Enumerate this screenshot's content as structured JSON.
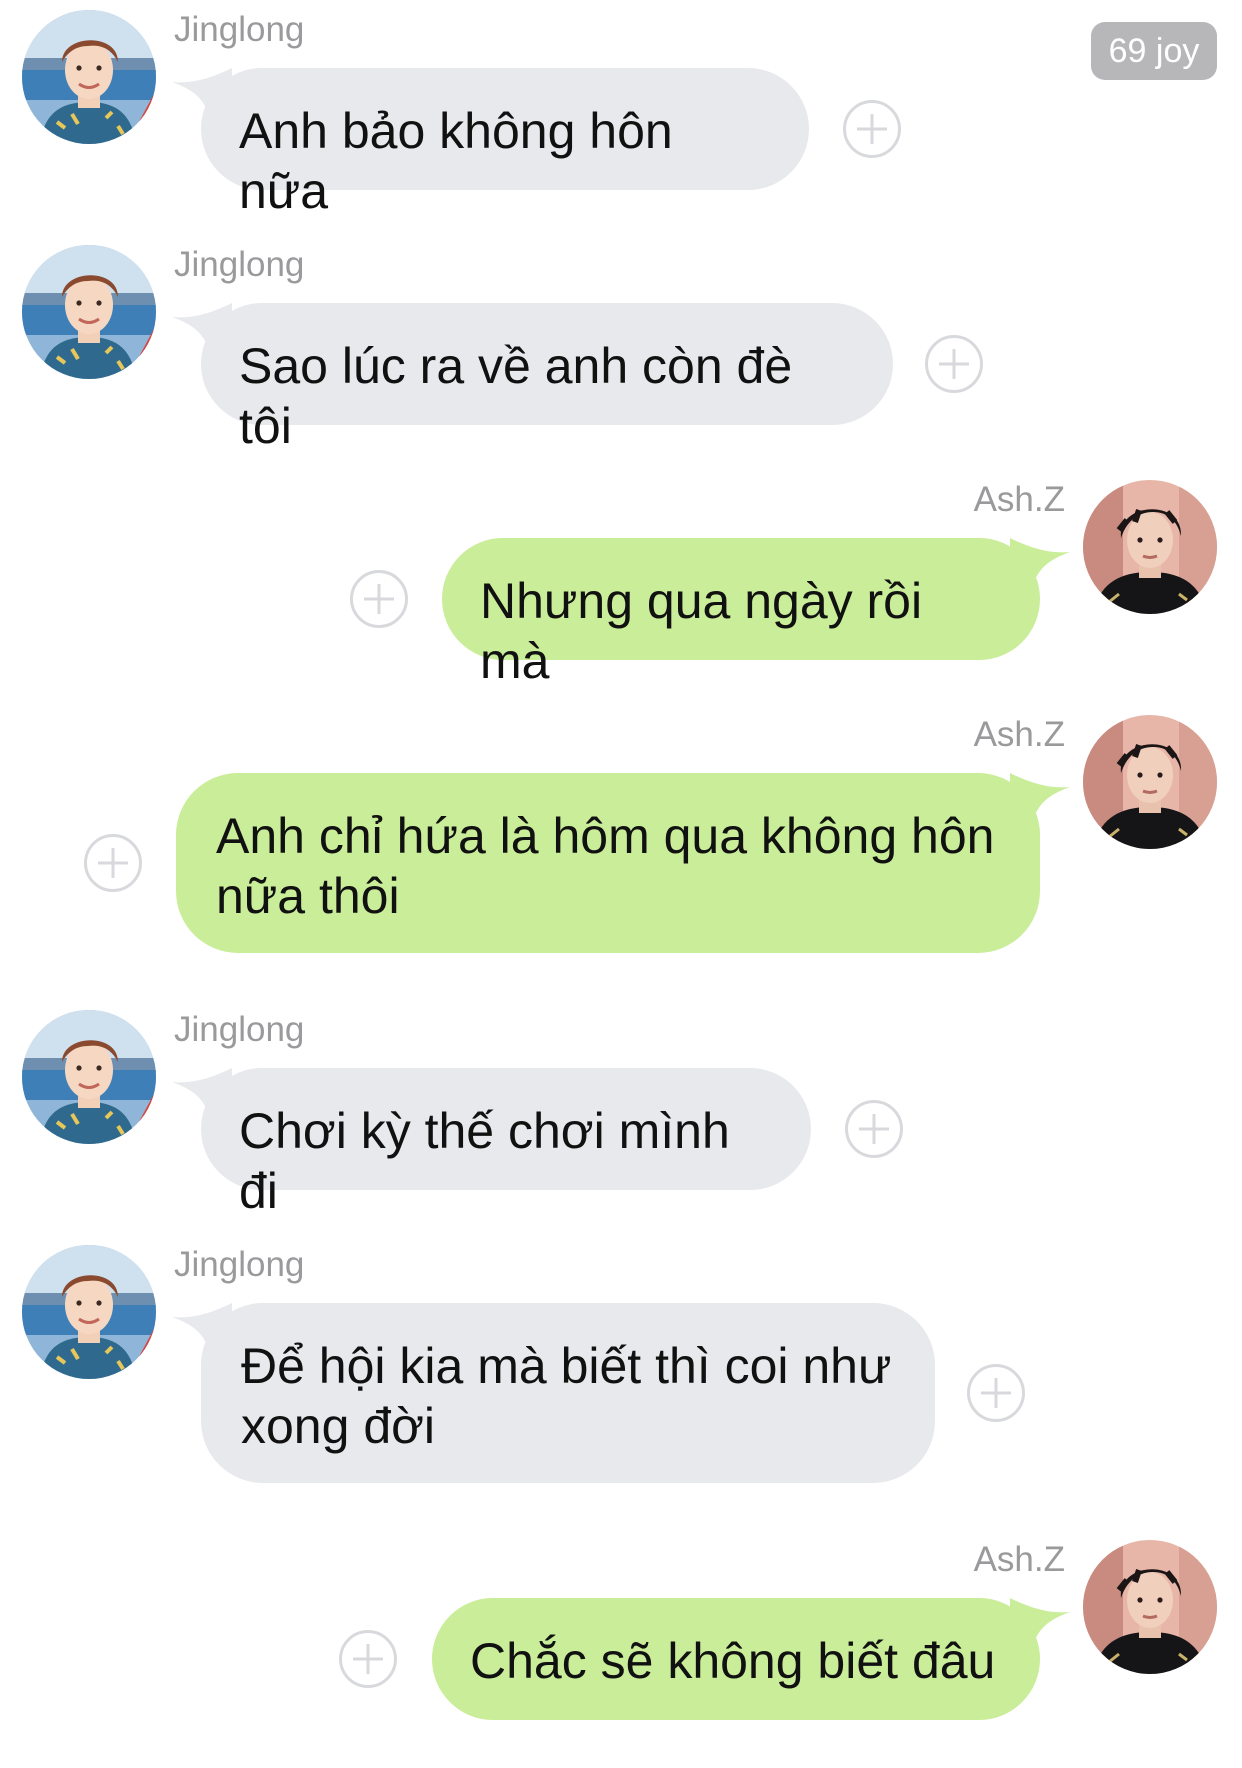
{
  "badge": {
    "label": "69 joy"
  },
  "messages": [
    {
      "sender": "Jinglong",
      "text": "Anh bảo không hôn nữa"
    },
    {
      "sender": "Jinglong",
      "text": "Sao lúc ra về anh còn đè tôi"
    },
    {
      "sender": "Ash.Z",
      "text": "Nhưng qua ngày rồi mà"
    },
    {
      "sender": "Ash.Z",
      "text": "Anh chỉ hứa là hôm qua không hôn nữa thôi"
    },
    {
      "sender": "Jinglong",
      "text": "Chơi kỳ thế chơi mình đi"
    },
    {
      "sender": "Jinglong",
      "text": "Để hội kia mà biết thì coi như xong đời"
    },
    {
      "sender": "Ash.Z",
      "text": "Chắc sẽ không biết đâu"
    }
  ],
  "colors": {
    "incoming_bubble": "#e8e9ec",
    "outgoing_bubble": "#c9ed99",
    "sender_name": "#9a9a9d",
    "badge_bg": "#b7b7b9",
    "add_icon": "#d8d9dc"
  },
  "icons": {
    "add": "plus-circle-icon",
    "avatar_incoming": "avatar-jinglong",
    "avatar_outgoing": "avatar-ash-z"
  }
}
